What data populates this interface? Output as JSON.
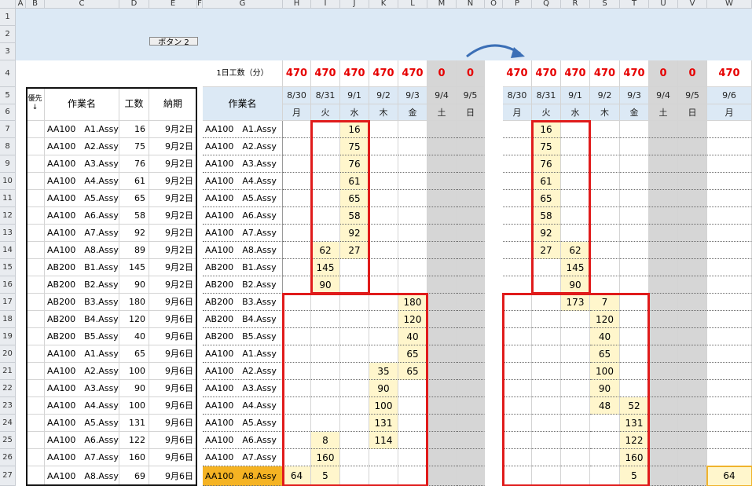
{
  "column_letters": [
    "A",
    "B",
    "C",
    "D",
    "E",
    "F",
    "G",
    "H",
    "I",
    "J",
    "K",
    "L",
    "M",
    "N",
    "O",
    "P",
    "Q",
    "R",
    "S",
    "T",
    "U",
    "V",
    "W"
  ],
  "row_numbers": [
    "1",
    "2",
    "3",
    "4",
    "5",
    "6",
    "7",
    "8",
    "9",
    "10",
    "11",
    "12",
    "13",
    "14",
    "15",
    "16",
    "17",
    "18",
    "19",
    "20",
    "21",
    "22",
    "23",
    "24",
    "25",
    "26",
    "27"
  ],
  "button_label": "ボタン 2",
  "daily_label": "1日工数（分）",
  "left_table": {
    "headers": [
      "優先\n↓",
      "作業名",
      "工数",
      "納期"
    ],
    "rows": [
      [
        "AA100　A1.Assy",
        "16",
        "9月2日"
      ],
      [
        "AA100　A2.Assy",
        "75",
        "9月2日"
      ],
      [
        "AA100　A3.Assy",
        "76",
        "9月2日"
      ],
      [
        "AA100　A4.Assy",
        "61",
        "9月2日"
      ],
      [
        "AA100　A5.Assy",
        "65",
        "9月2日"
      ],
      [
        "AA100　A6.Assy",
        "58",
        "9月2日"
      ],
      [
        "AA100　A7.Assy",
        "92",
        "9月2日"
      ],
      [
        "AA100　A8.Assy",
        "89",
        "9月2日"
      ],
      [
        "AB200　B1.Assy",
        "145",
        "9月2日"
      ],
      [
        "AB200　B2.Assy",
        "90",
        "9月2日"
      ],
      [
        "AB200　B3.Assy",
        "180",
        "9月6日"
      ],
      [
        "AB200　B4.Assy",
        "120",
        "9月6日"
      ],
      [
        "AB200　B5.Assy",
        "40",
        "9月6日"
      ],
      [
        "AA100　A1.Assy",
        "65",
        "9月6日"
      ],
      [
        "AA100　A2.Assy",
        "100",
        "9月6日"
      ],
      [
        "AA100　A3.Assy",
        "90",
        "9月6日"
      ],
      [
        "AA100　A4.Assy",
        "100",
        "9月6日"
      ],
      [
        "AA100　A5.Assy",
        "131",
        "9月6日"
      ],
      [
        "AA100　A6.Assy",
        "122",
        "9月6日"
      ],
      [
        "AA100　A7.Assy",
        "160",
        "9月6日"
      ],
      [
        "AA100　A8.Assy",
        "69",
        "9月6日"
      ]
    ]
  },
  "schedule_header": "作業名",
  "task_names": [
    "AA100　A1.Assy",
    "AA100　A2.Assy",
    "AA100　A3.Assy",
    "AA100　A4.Assy",
    "AA100　A5.Assy",
    "AA100　A6.Assy",
    "AA100　A7.Assy",
    "AA100　A8.Assy",
    "AB200　B1.Assy",
    "AB200　B2.Assy",
    "AB200　B3.Assy",
    "AB200　B4.Assy",
    "AB200　B5.Assy",
    "AA100　A1.Assy",
    "AA100　A2.Assy",
    "AA100　A3.Assy",
    "AA100　A4.Assy",
    "AA100　A5.Assy",
    "AA100　A6.Assy",
    "AA100　A7.Assy",
    "AA100　A8.Assy"
  ],
  "before": {
    "capacity": [
      "470",
      "470",
      "470",
      "470",
      "470",
      "0",
      "0"
    ],
    "dates": [
      "8/30",
      "8/31",
      "9/1",
      "9/2",
      "9/3",
      "9/4",
      "9/5"
    ],
    "weekdays": [
      "月",
      "火",
      "水",
      "木",
      "金",
      "土",
      "日"
    ],
    "cells": [
      [
        "",
        "",
        "16",
        "",
        "",
        "",
        ""
      ],
      [
        "",
        "",
        "75",
        "",
        "",
        "",
        ""
      ],
      [
        "",
        "",
        "76",
        "",
        "",
        "",
        ""
      ],
      [
        "",
        "",
        "61",
        "",
        "",
        "",
        ""
      ],
      [
        "",
        "",
        "65",
        "",
        "",
        "",
        ""
      ],
      [
        "",
        "",
        "58",
        "",
        "",
        "",
        ""
      ],
      [
        "",
        "",
        "92",
        "",
        "",
        "",
        ""
      ],
      [
        "",
        "62",
        "27",
        "",
        "",
        "",
        ""
      ],
      [
        "",
        "145",
        "",
        "",
        "",
        "",
        ""
      ],
      [
        "",
        "90",
        "",
        "",
        "",
        "",
        ""
      ],
      [
        "",
        "",
        "",
        "",
        "180",
        "",
        ""
      ],
      [
        "",
        "",
        "",
        "",
        "120",
        "",
        ""
      ],
      [
        "",
        "",
        "",
        "",
        "40",
        "",
        ""
      ],
      [
        "",
        "",
        "",
        "",
        "65",
        "",
        ""
      ],
      [
        "",
        "",
        "",
        "35",
        "65",
        "",
        ""
      ],
      [
        "",
        "",
        "",
        "90",
        "",
        "",
        ""
      ],
      [
        "",
        "",
        "",
        "100",
        "",
        "",
        ""
      ],
      [
        "",
        "",
        "",
        "131",
        "",
        "",
        ""
      ],
      [
        "",
        "8",
        "",
        "114",
        "",
        "",
        ""
      ],
      [
        "",
        "160",
        "",
        "",
        "",
        "",
        ""
      ],
      [
        "64",
        "5",
        "",
        "",
        "",
        "",
        ""
      ]
    ]
  },
  "after": {
    "capacity": [
      "470",
      "470",
      "470",
      "470",
      "470",
      "0",
      "0",
      "470"
    ],
    "dates": [
      "8/30",
      "8/31",
      "9/1",
      "9/2",
      "9/3",
      "9/4",
      "9/5",
      "9/6"
    ],
    "weekdays": [
      "月",
      "火",
      "水",
      "木",
      "金",
      "土",
      "日",
      "月"
    ],
    "cells": [
      [
        "",
        "16",
        "",
        "",
        "",
        "",
        "",
        ""
      ],
      [
        "",
        "75",
        "",
        "",
        "",
        "",
        "",
        ""
      ],
      [
        "",
        "76",
        "",
        "",
        "",
        "",
        "",
        ""
      ],
      [
        "",
        "61",
        "",
        "",
        "",
        "",
        "",
        ""
      ],
      [
        "",
        "65",
        "",
        "",
        "",
        "",
        "",
        ""
      ],
      [
        "",
        "58",
        "",
        "",
        "",
        "",
        "",
        ""
      ],
      [
        "",
        "92",
        "",
        "",
        "",
        "",
        "",
        ""
      ],
      [
        "",
        "27",
        "62",
        "",
        "",
        "",
        "",
        ""
      ],
      [
        "",
        "",
        "145",
        "",
        "",
        "",
        "",
        ""
      ],
      [
        "",
        "",
        "90",
        "",
        "",
        "",
        "",
        ""
      ],
      [
        "",
        "",
        "173",
        "7",
        "",
        "",
        "",
        ""
      ],
      [
        "",
        "",
        "",
        "120",
        "",
        "",
        "",
        ""
      ],
      [
        "",
        "",
        "",
        "40",
        "",
        "",
        "",
        ""
      ],
      [
        "",
        "",
        "",
        "65",
        "",
        "",
        "",
        ""
      ],
      [
        "",
        "",
        "",
        "100",
        "",
        "",
        "",
        ""
      ],
      [
        "",
        "",
        "",
        "90",
        "",
        "",
        "",
        ""
      ],
      [
        "",
        "",
        "",
        "48",
        "52",
        "",
        "",
        ""
      ],
      [
        "",
        "",
        "",
        "",
        "131",
        "",
        "",
        ""
      ],
      [
        "",
        "",
        "",
        "",
        "122",
        "",
        "",
        ""
      ],
      [
        "",
        "",
        "",
        "",
        "160",
        "",
        "",
        ""
      ],
      [
        "",
        "",
        "",
        "",
        "5",
        "",
        "",
        "64"
      ]
    ]
  },
  "colors": {
    "frame_red": "#e01b1b",
    "capacity_red": "#e60000",
    "filled_cell": "#fff6cc",
    "weekend": "#d6d6d6",
    "header_blue": "#dce9f5",
    "selected_task": "#f5b323",
    "arrow": "#3b6fb6"
  },
  "selected_task_row": 20,
  "icons": [
    "curved-arrow-icon"
  ]
}
